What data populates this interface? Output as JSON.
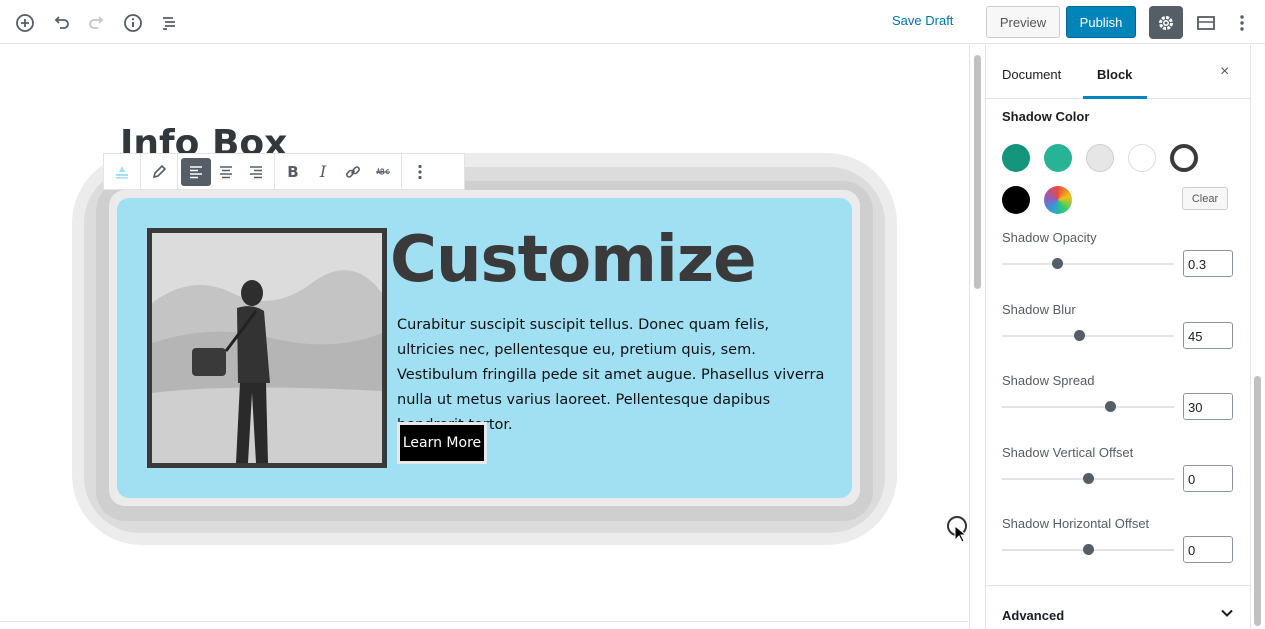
{
  "topbar": {
    "save_draft": "Save Draft",
    "preview": "Preview",
    "publish": "Publish",
    "icons": [
      "add-block-icon",
      "undo-icon",
      "redo-icon",
      "info-icon",
      "outline-icon",
      "gear-icon",
      "fullwidth-icon",
      "more-vertical-icon"
    ]
  },
  "editor": {
    "block_title": "Info Box",
    "heading": "Customize",
    "body": "Curabitur suscipit suscipit tellus. Donec quam felis, ultricies nec, pellentesque eu, pretium quis, sem. Vestibulum fringilla pede sit amet augue. Phasellus viverra nulla ut metus varius laoreet. Pellentesque dapibus hendrerit tortor.",
    "button": "Learn More",
    "toolbar_icons": [
      "block-type-icon",
      "pencil-icon",
      "align-left-icon",
      "align-center-icon",
      "align-right-icon",
      "bold-icon",
      "italic-icon",
      "link-icon",
      "strikethrough-icon",
      "more-options-icon"
    ],
    "bold": "B",
    "italic": "I",
    "card_bg": "#a1e0f3"
  },
  "sidebar": {
    "tab_document": "Document",
    "tab_block": "Block",
    "close": "×",
    "shadow_color_title": "Shadow Color",
    "swatches": [
      "#14967c",
      "#27b395",
      "#e6e6e6",
      "#ffffff",
      "#3a3a3a",
      "#000000",
      "gradient"
    ],
    "clear": "Clear",
    "controls": [
      {
        "label": "Shadow Opacity",
        "value": "0.3",
        "fraction": 0.32
      },
      {
        "label": "Shadow Blur",
        "value": "45",
        "fraction": 0.45
      },
      {
        "label": "Shadow Spread",
        "value": "30",
        "fraction": 0.63
      },
      {
        "label": "Shadow Vertical Offset",
        "value": "0",
        "fraction": 0.5
      },
      {
        "label": "Shadow Horizontal Offset",
        "value": "0",
        "fraction": 0.5
      }
    ],
    "advanced": "Advanced"
  }
}
